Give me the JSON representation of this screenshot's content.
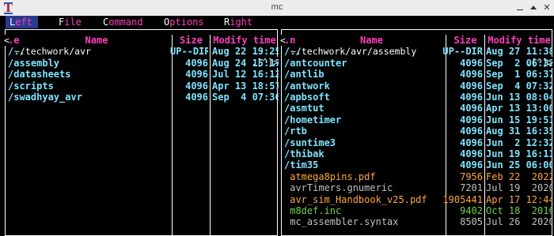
{
  "window": {
    "title": "mc",
    "icon": "midnight-commander-icon",
    "controls": [
      "minimize",
      "maximize",
      "close"
    ]
  },
  "menubar": {
    "items": [
      {
        "hot": "L",
        "rest": "eft"
      },
      {
        "hot": "F",
        "rest": "ile"
      },
      {
        "hot": "C",
        "rest": "ommand"
      },
      {
        "hot": "O",
        "rest": "ptions"
      },
      {
        "hot": "R",
        "rest": "ight"
      }
    ],
    "active": "Left"
  },
  "panels": {
    "left": {
      "path": "~/techwork/avr",
      "header_left": "<",
      "header_right": ".[^]>",
      "columns": {
        "sort": ".e",
        "name": "Name",
        "size": "Size",
        "mtime": "Modify time"
      },
      "rows": [
        {
          "name": "/..",
          "size": "UP--DIR",
          "mtime": "Aug 22 19:25",
          "kind": "dir"
        },
        {
          "name": "/assembly",
          "size": "4096",
          "mtime": "Aug 24 15:17",
          "kind": "dir"
        },
        {
          "name": "/datasheets",
          "size": "4096",
          "mtime": "Jul 12 16:12",
          "kind": "dir"
        },
        {
          "name": "/scripts",
          "size": "4096",
          "mtime": "Apr 13 18:57",
          "kind": "dir"
        },
        {
          "name": "/swadhyay_avr",
          "size": "4096",
          "mtime": "Sep  4 07:36",
          "kind": "dir"
        }
      ]
    },
    "right": {
      "path": "~/techwork/avr/assembly",
      "header_left": "<",
      "header_right": ".[^]>",
      "columns": {
        "sort": ".n",
        "name": "Name",
        "size": "Size",
        "mtime": "Modify time"
      },
      "rows": [
        {
          "name": "/..",
          "size": "UP--DIR",
          "mtime": "Aug 27 11:38",
          "kind": "dir"
        },
        {
          "name": "/antcounter",
          "size": "4096",
          "mtime": "Sep  2 06:32",
          "kind": "dir"
        },
        {
          "name": "/antlib",
          "size": "4096",
          "mtime": "Sep  1 06:37",
          "kind": "dir"
        },
        {
          "name": "/antwork",
          "size": "4096",
          "mtime": "Sep  4 07:32",
          "kind": "dir"
        },
        {
          "name": "/apbsoft",
          "size": "4096",
          "mtime": "Jun 13 08:04",
          "kind": "dir"
        },
        {
          "name": "/asmtut",
          "size": "4096",
          "mtime": "Apr 13 13:00",
          "kind": "dir"
        },
        {
          "name": "/hometimer",
          "size": "4096",
          "mtime": "Jun 15 19:51",
          "kind": "dir"
        },
        {
          "name": "/rtb",
          "size": "4096",
          "mtime": "Aug 31 16:35",
          "kind": "dir"
        },
        {
          "name": "/suntime3",
          "size": "4096",
          "mtime": "Jun  2 12:32",
          "kind": "dir"
        },
        {
          "name": "/thibak",
          "size": "4096",
          "mtime": "Jun 19 16:11",
          "kind": "dir"
        },
        {
          "name": "/tim35",
          "size": "4096",
          "mtime": "Jun 25 06:00",
          "kind": "dir"
        },
        {
          "name": " atmega8pins.pdf",
          "size": "7956",
          "mtime": "Feb 22  2022",
          "kind": "orange"
        },
        {
          "name": " avrTimers.gnumeric",
          "size": "7201",
          "mtime": "Jul 19  2020",
          "kind": "grey"
        },
        {
          "name": " avr_sim_Handbook_v25.pdf",
          "size": "1905441",
          "mtime": "Apr 17 12:44",
          "kind": "orange"
        },
        {
          "name": " m8def.inc",
          "size": "9402",
          "mtime": "Oct 18  2016",
          "kind": "green"
        },
        {
          "name": " mc_assembler.syntax",
          "size": "8505",
          "mtime": "Jul 26  2020",
          "kind": "grey"
        }
      ]
    }
  },
  "colors": {
    "background": "#000000",
    "directory": "#7fe3ff",
    "header": "#ff3fbf",
    "pdf": "#ffa640",
    "inc": "#6fd24c",
    "other_file": "#c0c0c0",
    "menu_active_bg": "#2a3a8c"
  }
}
